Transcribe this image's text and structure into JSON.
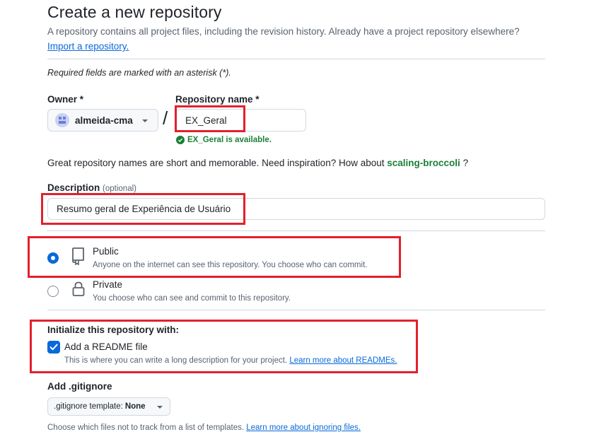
{
  "header": {
    "title": "Create a new repository",
    "subtitle": "A repository contains all project files, including the revision history. Already have a project repository elsewhere?",
    "import_link": "Import a repository."
  },
  "required_note": "Required fields are marked with an asterisk (*).",
  "owner": {
    "label": "Owner *",
    "value": "almeida-cma"
  },
  "separator": "/",
  "repository_name": {
    "label": "Repository name *",
    "value": "EX_Geral",
    "availability": "EX_Geral is available."
  },
  "inspiration": {
    "text": "Great repository names are short and memorable. Need inspiration? How about",
    "suggestion": "scaling-broccoli",
    "end": "?"
  },
  "description": {
    "label": "Description",
    "optional": "(optional)",
    "value": "Resumo geral de Experiência de Usuário"
  },
  "visibility": {
    "public": {
      "title": "Public",
      "description": "Anyone on the internet can see this repository. You choose who can commit.",
      "selected": true
    },
    "private": {
      "title": "Private",
      "description": "You choose who can see and commit to this repository.",
      "selected": false
    }
  },
  "initialize": {
    "heading": "Initialize this repository with:",
    "readme_label": "Add a README file",
    "readme_checked": true,
    "readme_description": "This is where you can write a long description for your project.",
    "readme_link": "Learn more about READMEs."
  },
  "gitignore": {
    "label": "Add .gitignore",
    "template_prefix": ".gitignore template:",
    "template_value": "None",
    "description": "Choose which files not to track from a list of templates.",
    "link": "Learn more about ignoring files."
  },
  "colors": {
    "accent": "#0969da",
    "success": "#1a7f37",
    "highlight": "#e3202d"
  }
}
